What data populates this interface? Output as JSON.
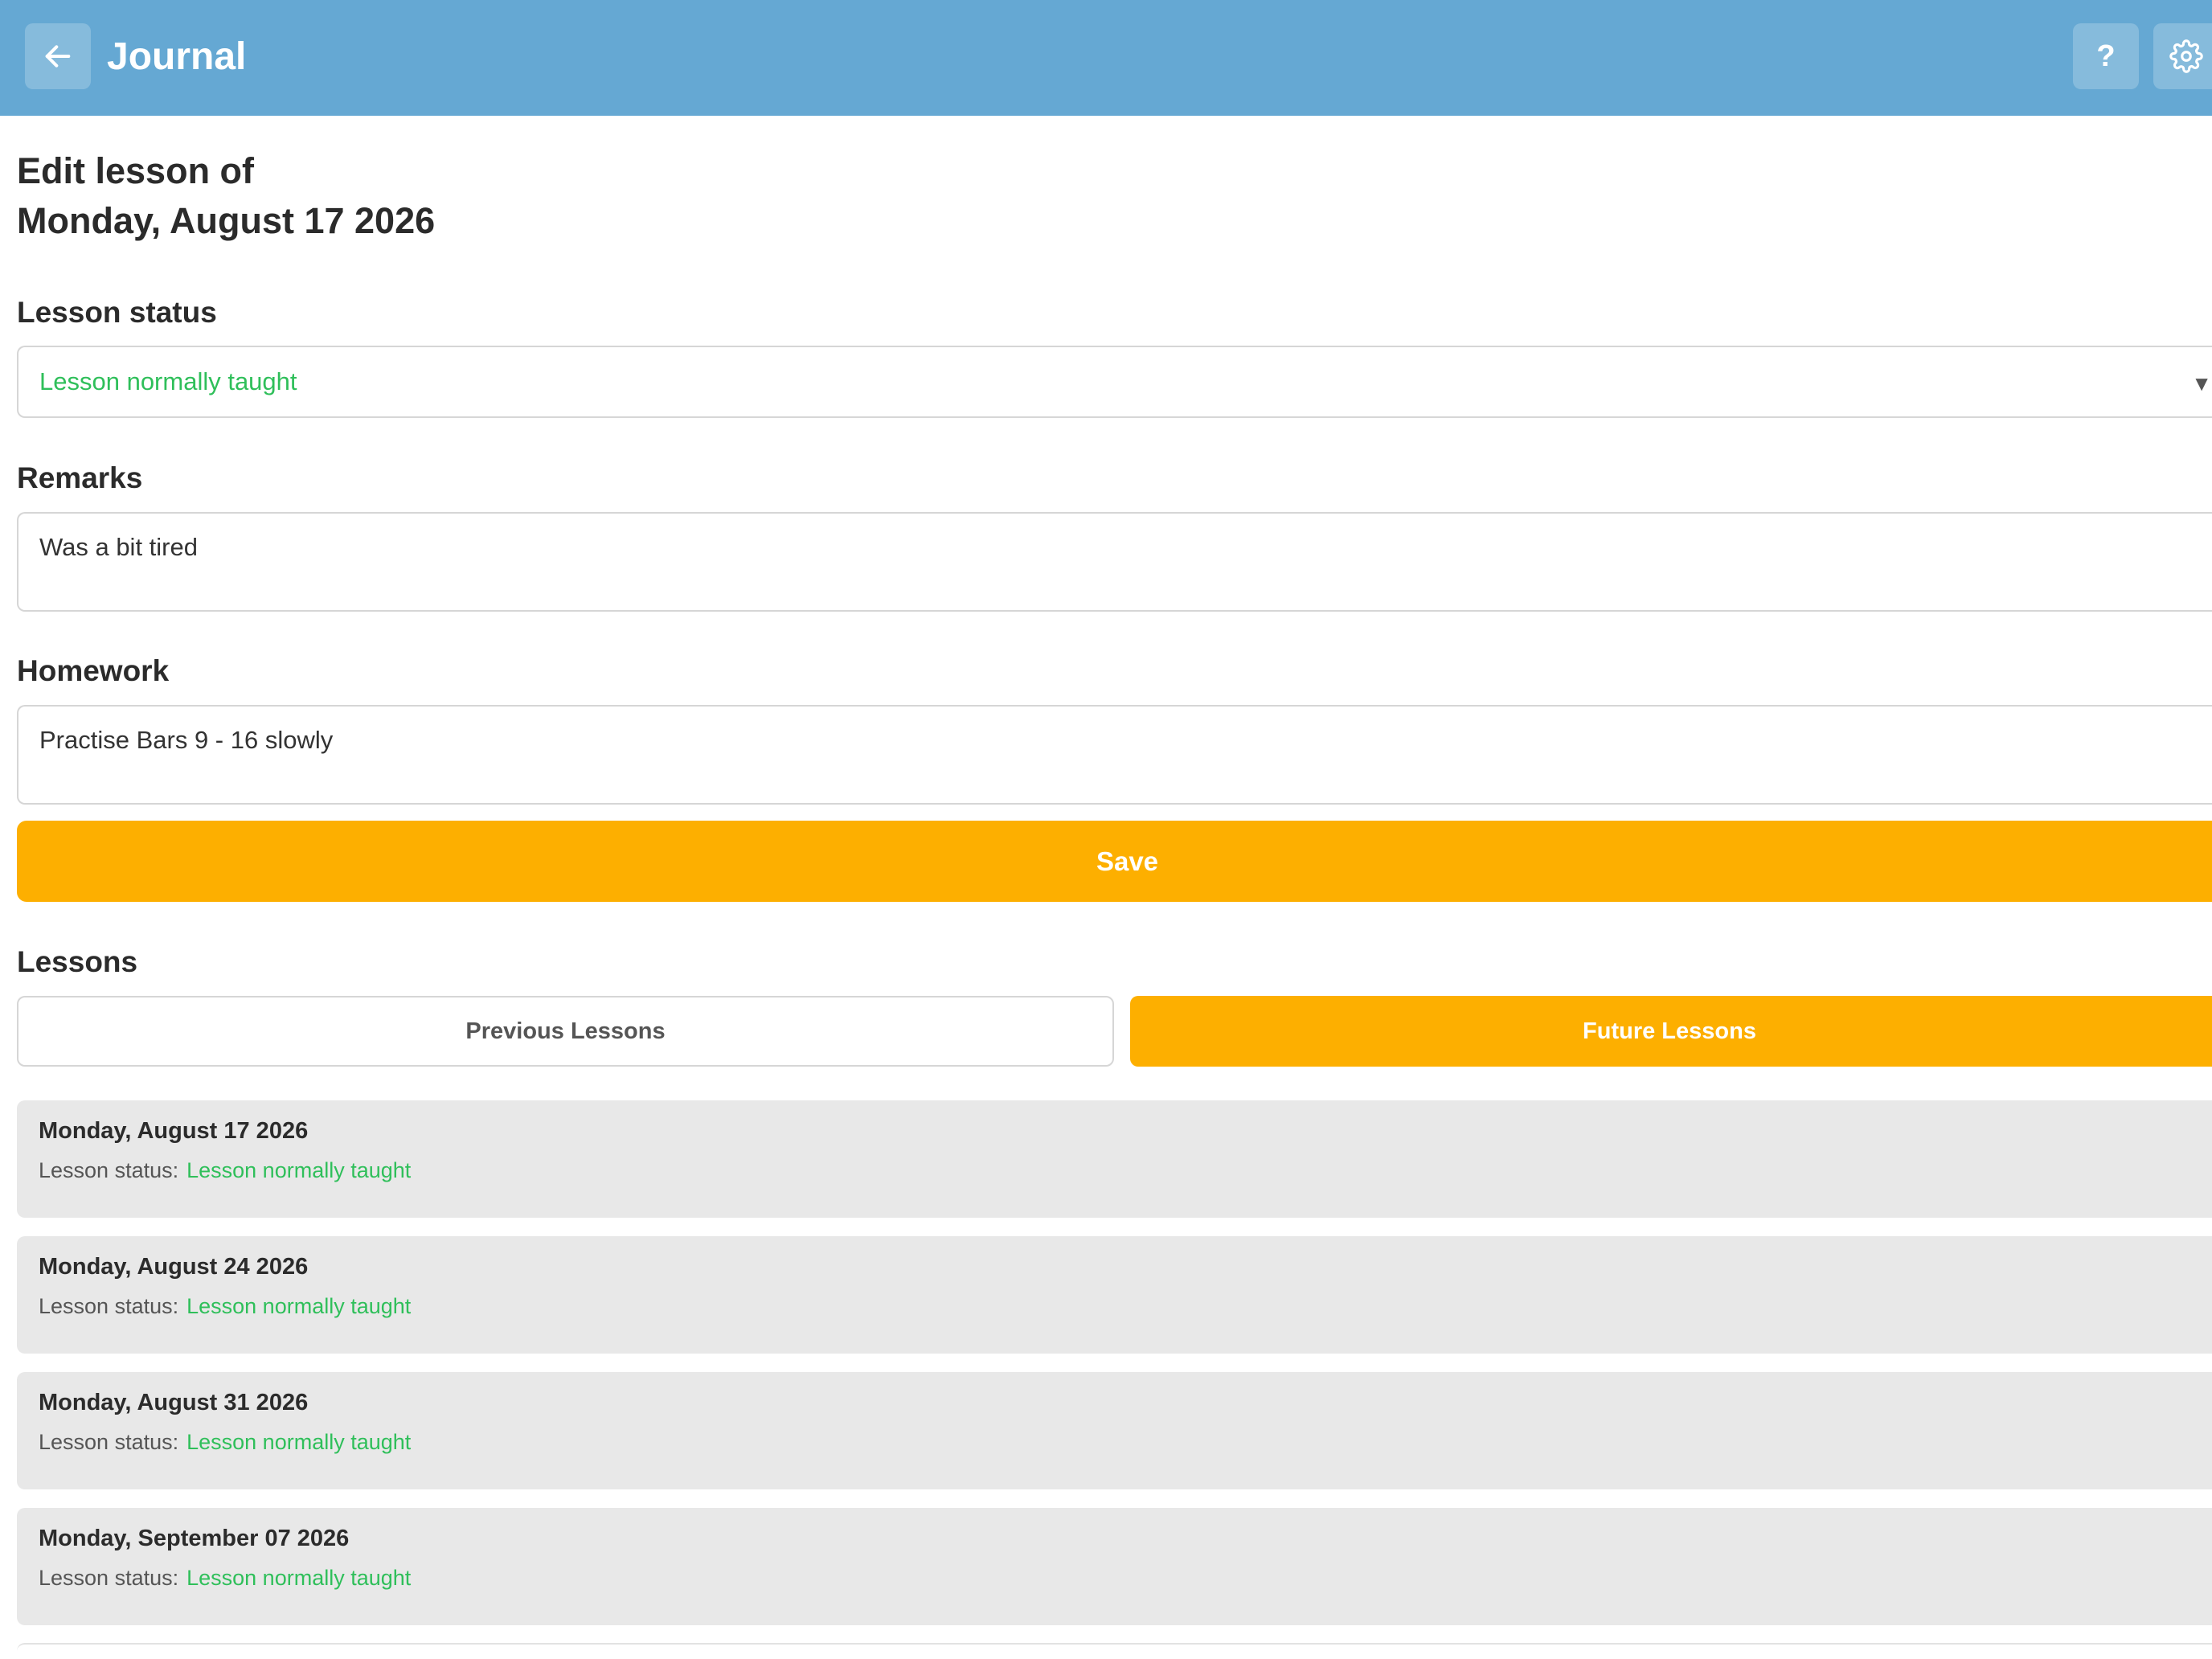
{
  "header": {
    "title": "Journal",
    "back_icon": "arrow-left-icon",
    "help_label": "?",
    "settings_icon": "gear-icon"
  },
  "page": {
    "title_line1": "Edit lesson of",
    "title_line2": "Monday, August 17 2026"
  },
  "form": {
    "status_label": "Lesson status",
    "status_value": "Lesson normally taught",
    "remarks_label": "Remarks",
    "remarks_value": "Was a bit tired",
    "homework_label": "Homework",
    "homework_value": "Practise Bars 9 - 16 slowly",
    "save_label": "Save"
  },
  "lessons": {
    "heading": "Lessons",
    "tabs": [
      {
        "label": "Previous Lessons",
        "active": false
      },
      {
        "label": "Future Lessons",
        "active": true
      }
    ],
    "status_prefix": "Lesson status:",
    "items": [
      {
        "date": "Monday, August 17 2026",
        "status": "Lesson normally taught"
      },
      {
        "date": "Monday, August 24 2026",
        "status": "Lesson normally taught"
      },
      {
        "date": "Monday, August 31 2026",
        "status": "Lesson normally taught"
      },
      {
        "date": "Monday, September 07 2026",
        "status": "Lesson normally taught"
      }
    ]
  },
  "colors": {
    "header_bg": "#65a8d3",
    "accent": "#fdaf00",
    "status_green": "#2fbf5a",
    "card_bg": "#e8e8e8"
  }
}
